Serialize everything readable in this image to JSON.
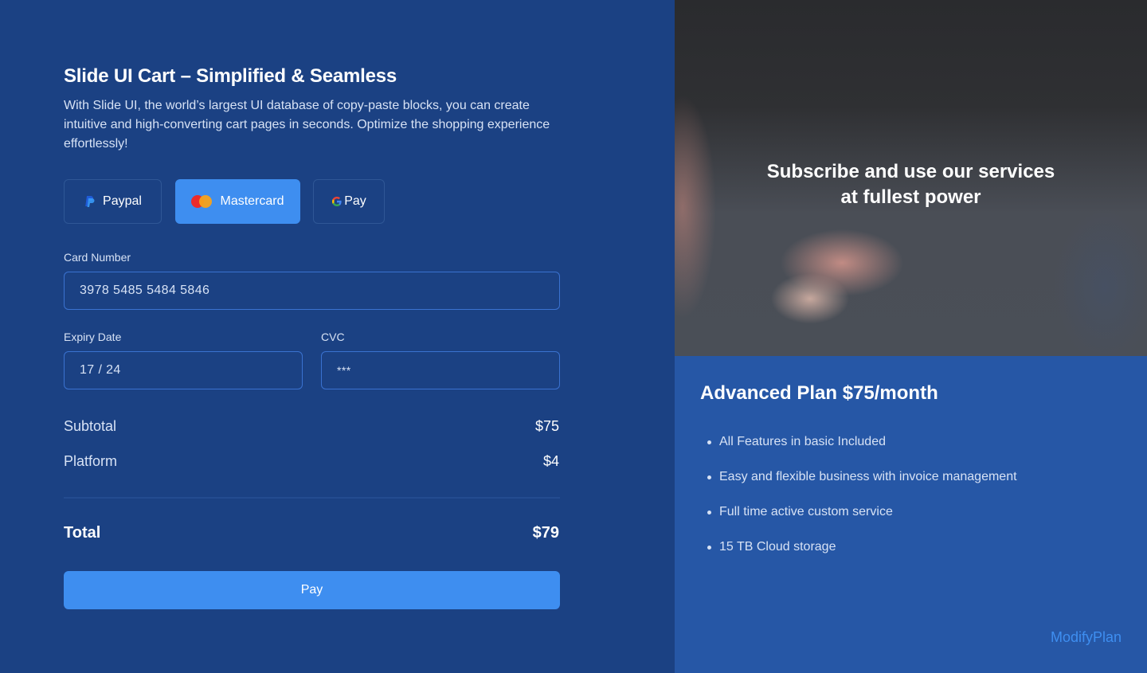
{
  "checkout": {
    "title": "Slide UI Cart – Simplified & Seamless",
    "description": "With Slide UI, the world’s largest UI database of copy-paste blocks, you can create intuitive and high-converting cart pages in seconds. Optimize the shopping experience effortlessly!",
    "payment_methods": [
      {
        "label": "Paypal",
        "icon": "paypal-icon",
        "selected": false
      },
      {
        "label": "Mastercard",
        "icon": "mastercard-icon",
        "selected": true
      },
      {
        "label": "Pay",
        "icon": "google-g-icon",
        "selected": false
      }
    ],
    "card_number_label": "Card Number",
    "card_number_value": "3978 5485 5484 5846",
    "expiry_label": "Expiry Date",
    "expiry_value": "17 / 24",
    "cvc_label": "CVC",
    "cvc_value": "***",
    "subtotal_label": "Subtotal",
    "subtotal_value": "$75",
    "platform_label": "Platform",
    "platform_value": "$4",
    "total_label": "Total",
    "total_value": "$79",
    "pay_button_label": "Pay"
  },
  "plan": {
    "hero_caption_line1": "Subscribe and use our services",
    "hero_caption_line2": "at fullest power",
    "title": "Advanced Plan $75/month",
    "features": [
      "All Features in basic Included",
      "Easy and flexible business with invoice management",
      "Full time active custom service",
      "15 TB Cloud storage"
    ],
    "modify_link": "ModifyPlan"
  },
  "colors": {
    "left_bg": "#1b4183",
    "right_bg": "#2657a6",
    "accent": "#3e8ef0"
  }
}
